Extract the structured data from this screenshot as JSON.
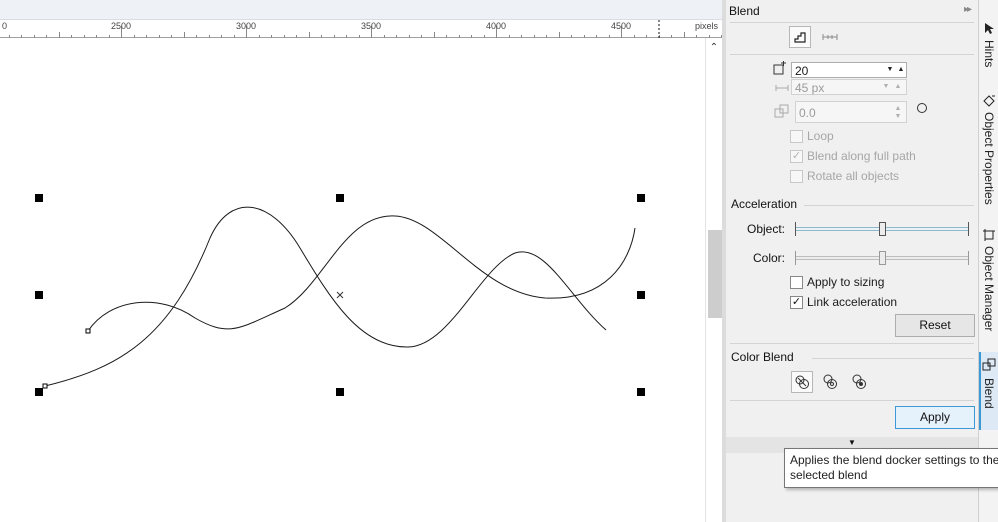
{
  "ruler": {
    "labels": [
      "0",
      "2500",
      "3000",
      "3500",
      "4000",
      "4500"
    ],
    "units": "pixels"
  },
  "docker": {
    "title": "Blend",
    "steps_value": "20",
    "spacing_value": "45 px",
    "rotation_value": "0.0",
    "loop_label": "Loop",
    "blend_along_path_label": "Blend along full path",
    "rotate_all_label": "Rotate all objects",
    "acceleration_label": "Acceleration",
    "object_label": "Object:",
    "color_label": "Color:",
    "object_acceleration": 0.5,
    "color_acceleration": 0.5,
    "apply_to_sizing_label": "Apply to sizing",
    "link_acceleration_label": "Link acceleration",
    "link_acceleration_checked": "✓",
    "blend_along_path_checked": "✓",
    "reset_label": "Reset",
    "color_blend_label": "Color Blend",
    "apply_label": "Apply",
    "collapse_arrow": "▼"
  },
  "tooltip": {
    "text": "Applies the blend docker settings to the selected blend"
  },
  "side_tabs": {
    "hints": "Hints",
    "object_properties": "Object Properties",
    "object_manager": "Object Manager",
    "blend": "Blend"
  },
  "colors": {
    "accent": "#3c99d6",
    "canvas": "#ffffff",
    "panel": "#f0f0f0"
  },
  "icons": {
    "steps": "steps-icon",
    "spacing": "spacing-icon",
    "rotation": "rotation-icon",
    "direct_blend": "direct-blend-icon",
    "clockwise_blend": "clockwise-blend-icon",
    "counterclockwise_blend": "counterclockwise-blend-icon"
  }
}
